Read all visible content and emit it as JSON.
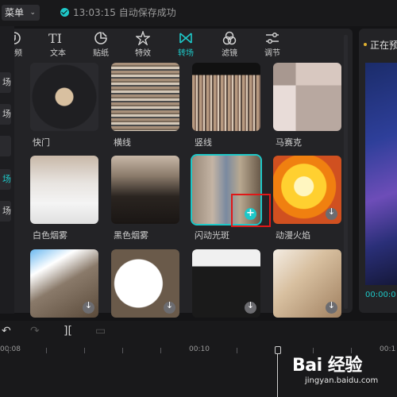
{
  "topbar": {
    "menu_label": "菜单",
    "save_time": "13:03:15",
    "save_text": "自动保存成功"
  },
  "left_strip": {
    "items": [
      {
        "label": "场",
        "active": false
      },
      {
        "label": "场",
        "active": false
      },
      {
        "label": "",
        "active": false
      },
      {
        "label": "场",
        "active": true
      },
      {
        "label": "场",
        "active": false
      }
    ]
  },
  "toolbar": {
    "tabs": [
      {
        "label": "音频",
        "icon": "audio-icon",
        "active": false
      },
      {
        "label": "文本",
        "icon": "text-icon",
        "active": false
      },
      {
        "label": "贴纸",
        "icon": "sticker-icon",
        "active": false
      },
      {
        "label": "特效",
        "icon": "effects-icon",
        "active": false
      },
      {
        "label": "转场",
        "icon": "transition-icon",
        "active": true
      },
      {
        "label": "滤镜",
        "icon": "filter-icon",
        "active": false
      },
      {
        "label": "调节",
        "icon": "adjust-icon",
        "active": false
      }
    ]
  },
  "transitions": [
    {
      "label": "快门",
      "downloaded": true
    },
    {
      "label": "横线",
      "downloaded": true
    },
    {
      "label": "竖线",
      "downloaded": true
    },
    {
      "label": "马赛克",
      "downloaded": true
    },
    {
      "label": "白色烟雾",
      "downloaded": true
    },
    {
      "label": "黑色烟雾",
      "downloaded": true
    },
    {
      "label": "闪动光斑",
      "downloaded": true,
      "selected": true
    },
    {
      "label": "动漫火焰",
      "downloaded": false
    },
    {
      "label": "",
      "downloaded": false
    },
    {
      "label": "",
      "downloaded": false
    },
    {
      "label": "",
      "downloaded": false
    },
    {
      "label": "",
      "downloaded": false
    }
  ],
  "preview": {
    "title": "正在预",
    "time": "00:00:0"
  },
  "timeline": {
    "ticks": [
      "00:08",
      "00:10",
      "00:1"
    ]
  },
  "watermark": {
    "main": "Bai 经验",
    "sub": "jingyan.baidu.com"
  },
  "colors": {
    "accent": "#1ec8c8",
    "highlight_box": "#e01818",
    "background": "#141416",
    "panel": "#232326"
  }
}
